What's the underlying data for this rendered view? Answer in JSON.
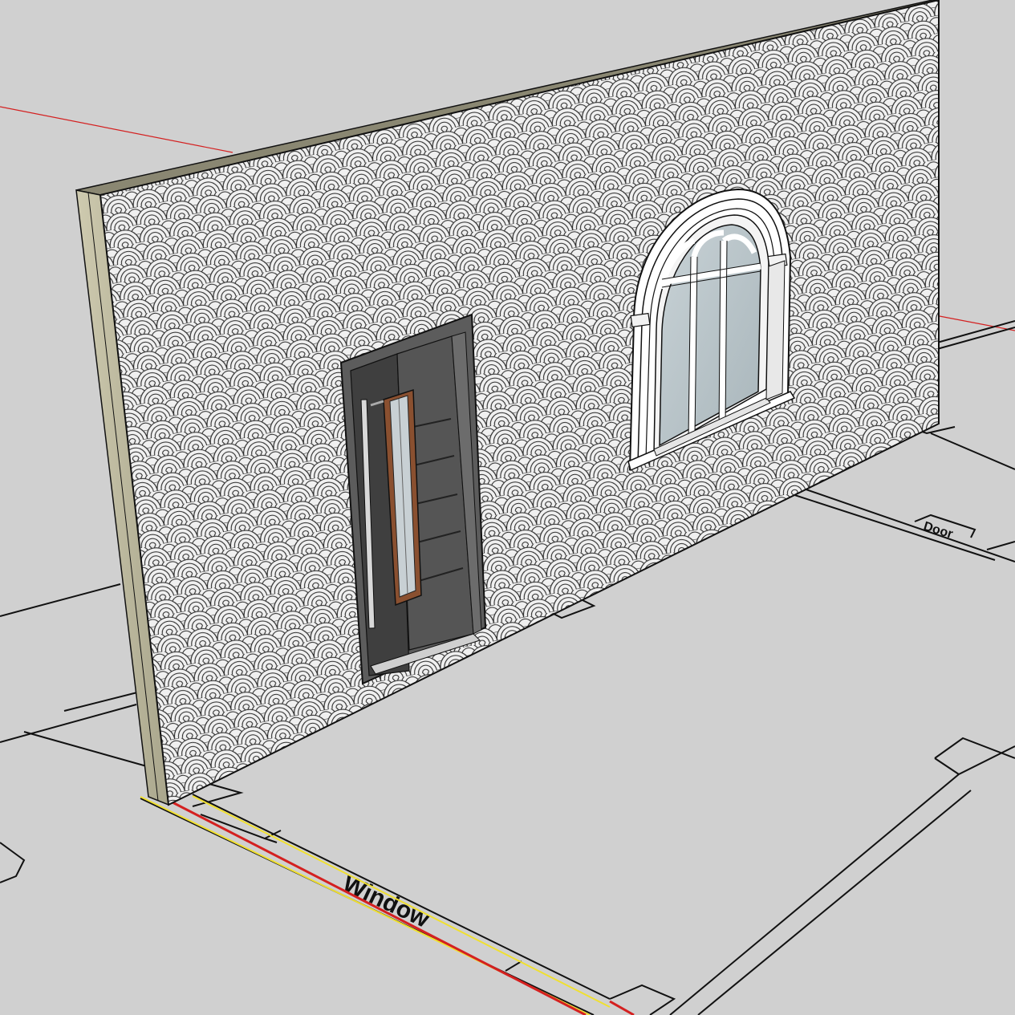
{
  "scene": {
    "background_color": "#d0d0d0",
    "floor_line_color": "#111111",
    "red_axis_color": "#d42020",
    "yellow_highlight_color": "#f0e030",
    "wall_pattern": "scallop-pattern",
    "wall_edge_color": "#b8b49a"
  },
  "labels": {
    "window_label": "Window",
    "right_label": "Door"
  },
  "objects": {
    "door": {
      "icon": "modern-door",
      "panel_color": "#4a4a4a",
      "frame_color": "#5c5c5c",
      "accent_color": "#8a5030"
    },
    "window": {
      "icon": "arched-window",
      "frame_color": "#ffffff",
      "glass_color": "#b8c4c8"
    }
  }
}
